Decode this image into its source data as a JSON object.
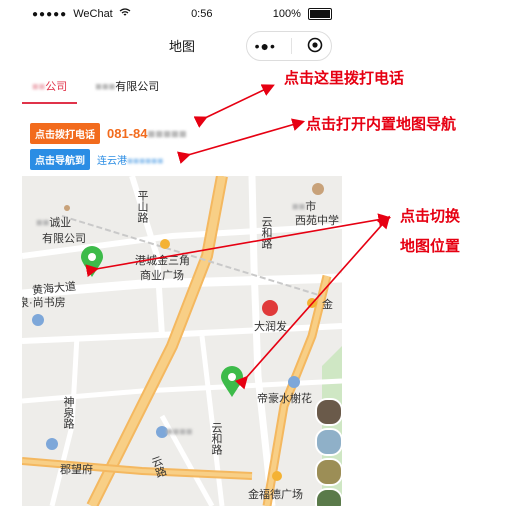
{
  "status": {
    "carrier": "WeChat",
    "time": "0:56",
    "battery": "100%"
  },
  "nav": {
    "title": "地图"
  },
  "tabs": [
    {
      "label": "有限公司",
      "visible_prefix": "",
      "suffix": "公司"
    },
    {
      "label": "有限公司"
    }
  ],
  "contact": {
    "call_button": "点击拨打电话",
    "phone": "081-84",
    "nav_button": "点击导航到",
    "address": "连云港"
  },
  "map": {
    "labels": {
      "pingshan": "平山路",
      "shengshi": "市",
      "xiyuan": "西苑中学",
      "youxian": "有限公司",
      "chengye": "诚业",
      "gangcheng": "港城金三角",
      "shangye": "商业广场",
      "huanghai": "黄海大道",
      "shufang": "泉·尚书房",
      "runfa": "大润发",
      "jin": "金",
      "yunhe": "云和路",
      "dihao": "帝豪水榭花",
      "shenyuan": "神泉路",
      "junwang": "郡望府",
      "jinfude": "金福德广场",
      "yunhe2": "云和路",
      "yunlu": "云路"
    }
  },
  "callouts": {
    "call": "点击这里拨打电话",
    "nav": "点击打开内置地图导航",
    "switch1": "点击切换",
    "switch2": "地图位置"
  },
  "colors": {
    "accent_red": "#e0334a",
    "orange": "#f26b1d",
    "blue": "#2b8de4",
    "marker_green": "#3dbb4a",
    "annotation_red": "#e60012"
  }
}
